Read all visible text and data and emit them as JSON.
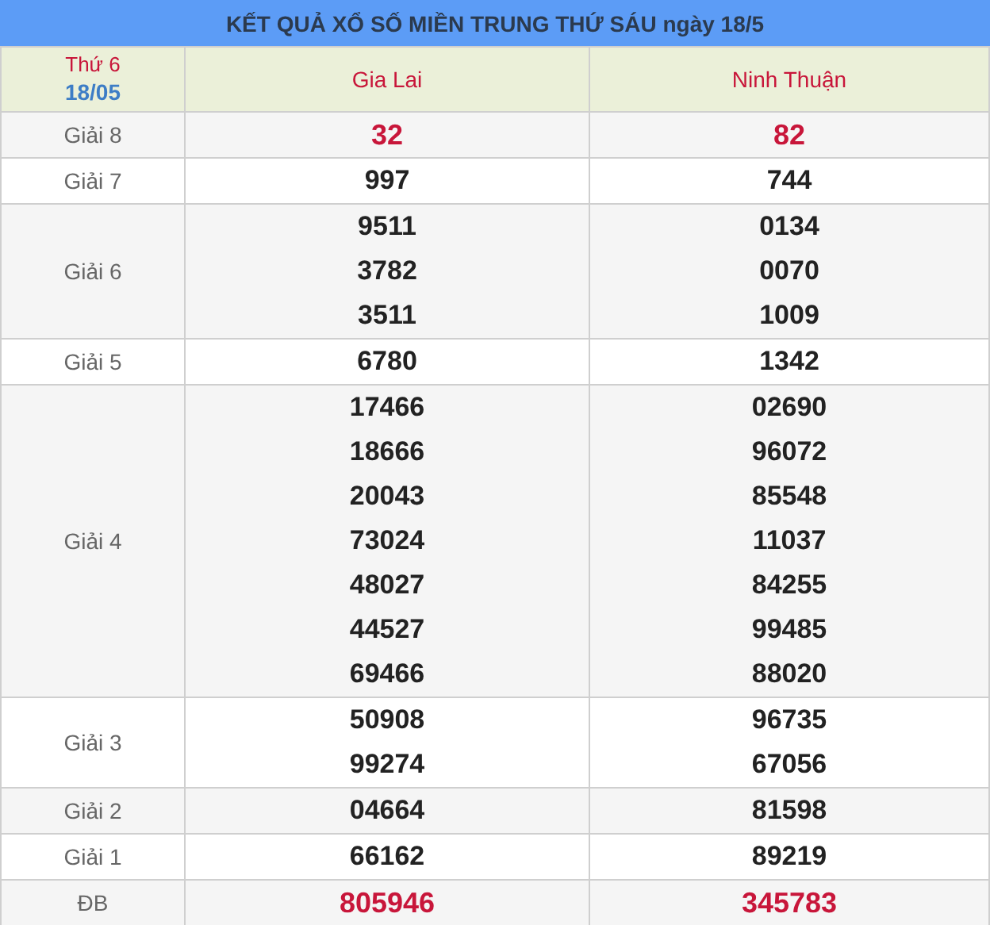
{
  "title": "KẾT QUẢ XỔ SỐ MIỀN TRUNG THỨ SÁU ngày 18/5",
  "header": {
    "day": "Thứ 6",
    "date": "18/05",
    "provinces": [
      "Gia Lai",
      "Ninh Thuận"
    ]
  },
  "rows": [
    {
      "prize": "Giải 8",
      "highlighted": true,
      "results": [
        [
          "32"
        ],
        [
          "82"
        ]
      ]
    },
    {
      "prize": "Giải 7",
      "highlighted": false,
      "results": [
        [
          "997"
        ],
        [
          "744"
        ]
      ]
    },
    {
      "prize": "Giải 6",
      "highlighted": false,
      "results": [
        [
          "9511",
          "3782",
          "3511"
        ],
        [
          "0134",
          "0070",
          "1009"
        ]
      ]
    },
    {
      "prize": "Giải 5",
      "highlighted": false,
      "results": [
        [
          "6780"
        ],
        [
          "1342"
        ]
      ]
    },
    {
      "prize": "Giải 4",
      "highlighted": false,
      "results": [
        [
          "17466",
          "18666",
          "20043",
          "73024",
          "48027",
          "44527",
          "69466"
        ],
        [
          "02690",
          "96072",
          "85548",
          "11037",
          "84255",
          "99485",
          "88020"
        ]
      ]
    },
    {
      "prize": "Giải 3",
      "highlighted": false,
      "results": [
        [
          "50908",
          "99274"
        ],
        [
          "96735",
          "67056"
        ]
      ]
    },
    {
      "prize": "Giải 2",
      "highlighted": false,
      "results": [
        [
          "04664"
        ],
        [
          "81598"
        ]
      ]
    },
    {
      "prize": "Giải 1",
      "highlighted": false,
      "results": [
        [
          "66162"
        ],
        [
          "89219"
        ]
      ]
    },
    {
      "prize": "ĐB",
      "highlighted": true,
      "results": [
        [
          "805946"
        ],
        [
          "345783"
        ]
      ]
    }
  ]
}
